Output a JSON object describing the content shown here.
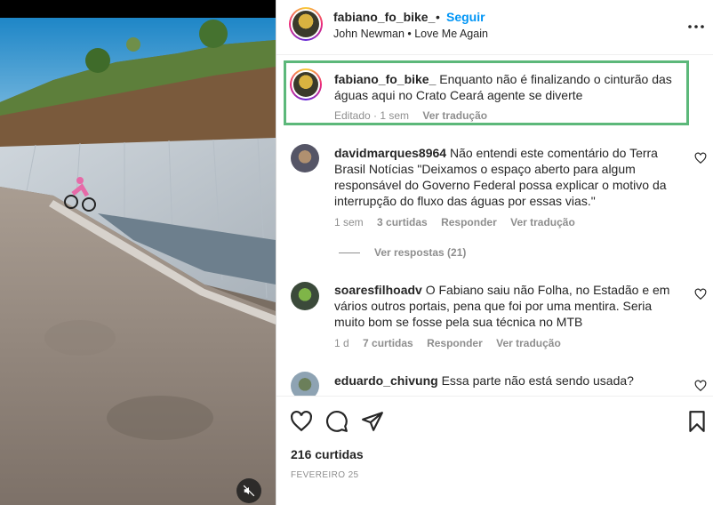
{
  "post": {
    "username": "fabiano_fo_bike_",
    "separator": "•",
    "follow_label": "Seguir",
    "audio": "John Newman • Love Me Again",
    "more_icon": "more-horizontal-icon"
  },
  "caption": {
    "username": "fabiano_fo_bike_",
    "text": "Enquanto não é finalizando o cinturão das águas aqui no Crato Ceará agente se diverte",
    "edited": "Editado · 1 sem",
    "translate": "Ver tradução",
    "highlight_color": "#5cb87a"
  },
  "comments": [
    {
      "username": "davidmarques8964",
      "text": "Não entendi este comentário do Terra Brasil Notícias \"Deixamos o espaço aberto para algum responsável do Governo Federal possa explicar o motivo da interrupção do fluxo das águas por essas vias.\"",
      "time": "1 sem",
      "likes": "3 curtidas",
      "reply": "Responder",
      "translate": "Ver tradução"
    },
    {
      "username": "soaresfilhoadv",
      "text": "O Fabiano saiu não Folha, no Estadão e em vários outros portais, pena que foi por uma mentira. Seria muito bom se fosse pela sua técnica no MTB",
      "time": "1 d",
      "likes": "7 curtidas",
      "reply": "Responder",
      "translate": "Ver tradução"
    },
    {
      "username": "eduardo_chivung",
      "text": "Essa parte não está sendo usada?"
    }
  ],
  "view_replies": "Ver respostas (21)",
  "footer": {
    "likes": "216 curtidas",
    "date": "FEVEREIRO 25"
  },
  "icons": {
    "like": "heart-icon",
    "comment": "comment-icon",
    "share": "paper-plane-icon",
    "save": "bookmark-icon",
    "mute": "speaker-muted-icon"
  },
  "colors": {
    "link_blue": "#0095f6",
    "muted_text": "#8e8e8e",
    "text": "#262626"
  }
}
